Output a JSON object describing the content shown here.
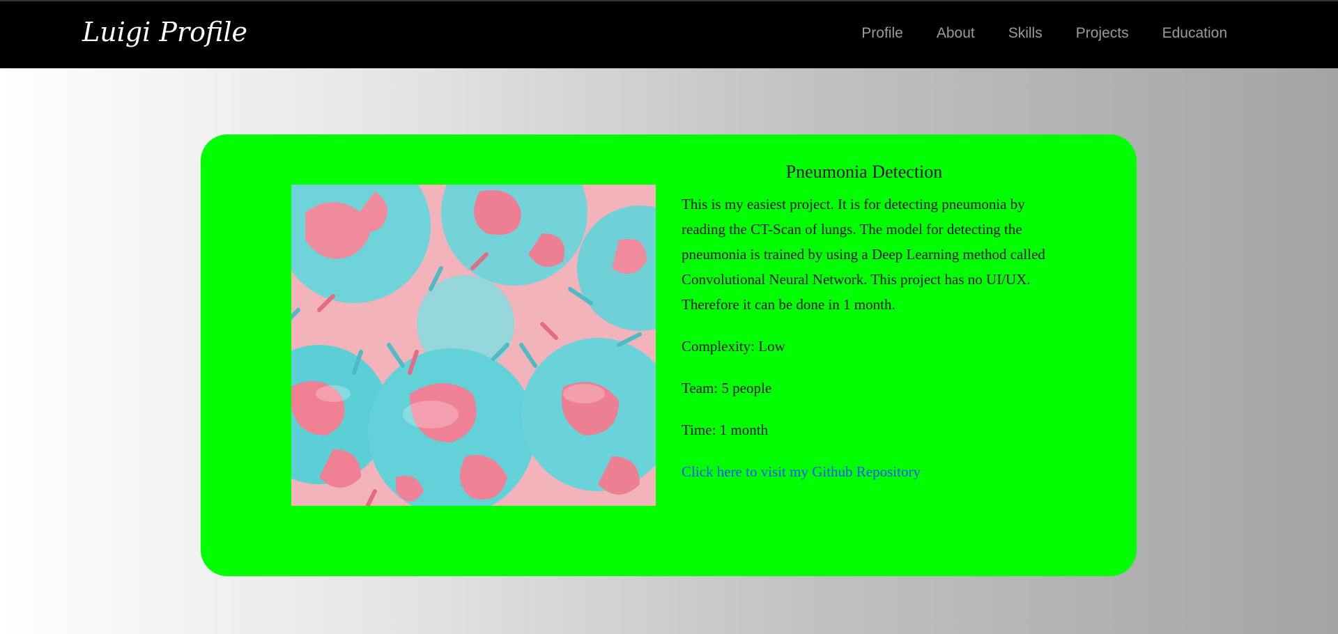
{
  "navbar": {
    "brand": "Luigi Profile",
    "links": [
      {
        "label": "Profile"
      },
      {
        "label": "About"
      },
      {
        "label": "Skills"
      },
      {
        "label": "Projects"
      },
      {
        "label": "Education"
      }
    ]
  },
  "project": {
    "title": "Pneumonia Detection",
    "description": "This is my easiest project. It is for detecting pneumonia by reading the CT-Scan of lungs. The model for detecting the pneumonia is trained by using a Deep Learning method called Convolutional Neural Network. This project has no UI/UX. Therefore it can be done in 1 month.",
    "complexity": "Complexity: Low",
    "team": "Team: 5 people",
    "time": "Time: 1 month",
    "repo_link": "Click here to visit my Github Repository",
    "image_icon": "virus-illustration"
  },
  "colors": {
    "navbar_bg": "#000000",
    "nav_link": "#9b9b9b",
    "card_bg": "#00ff00",
    "link": "#1a4dff",
    "virus_cyan": "#5ccfd6",
    "virus_pink": "#ef7f93",
    "image_bg": "#f2b3bb"
  }
}
